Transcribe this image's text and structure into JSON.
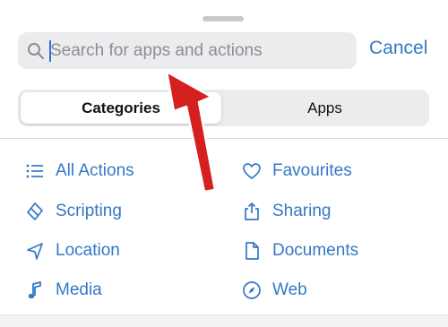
{
  "search": {
    "placeholder": "Search for apps and actions",
    "cancel_label": "Cancel"
  },
  "tabs": [
    {
      "label": "Categories",
      "selected": true
    },
    {
      "label": "Apps",
      "selected": false
    }
  ],
  "categories_left": [
    {
      "label": "All Actions",
      "icon": "list-icon"
    },
    {
      "label": "Scripting",
      "icon": "scripting-icon"
    },
    {
      "label": "Location",
      "icon": "location-arrow-icon"
    },
    {
      "label": "Media",
      "icon": "music-note-icon"
    }
  ],
  "categories_right": [
    {
      "label": "Favourites",
      "icon": "heart-icon"
    },
    {
      "label": "Sharing",
      "icon": "share-icon"
    },
    {
      "label": "Documents",
      "icon": "document-icon"
    },
    {
      "label": "Web",
      "icon": "compass-icon"
    }
  ],
  "colors": {
    "accent": "#3478c6",
    "annotation_arrow": "#d61f1f"
  }
}
